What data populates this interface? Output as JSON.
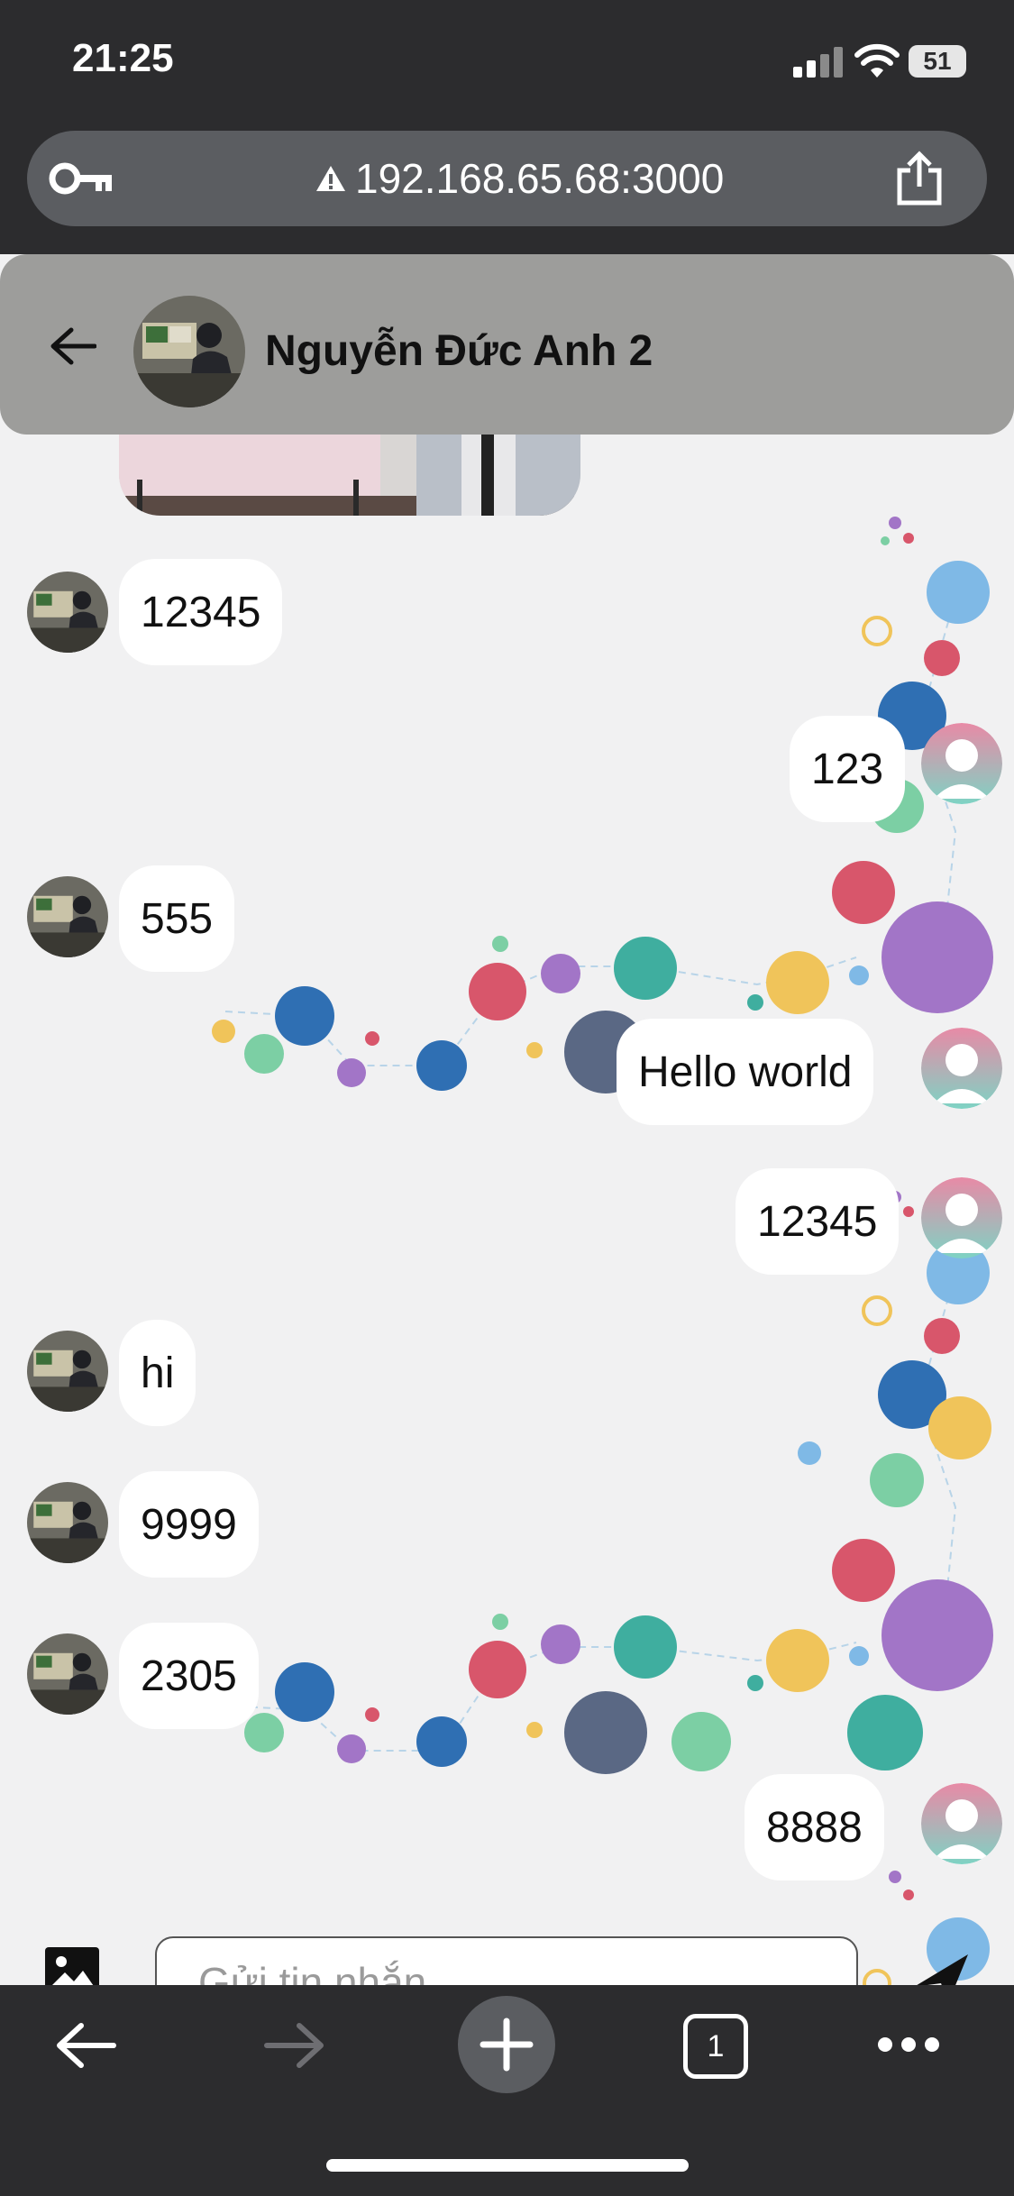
{
  "status_bar": {
    "time": "21:25",
    "battery": "51"
  },
  "browser": {
    "url": "192.168.65.68:3000"
  },
  "chat_header": {
    "contact_name": "Nguyễn Đức Anh 2"
  },
  "messages": [
    {
      "side": "received",
      "text": "12345"
    },
    {
      "side": "sent",
      "text": "123"
    },
    {
      "side": "received",
      "text": "555"
    },
    {
      "side": "sent",
      "text": "Hello world"
    },
    {
      "side": "sent",
      "text": "12345"
    },
    {
      "side": "received",
      "text": "hi"
    },
    {
      "side": "received",
      "text": "9999"
    },
    {
      "side": "received",
      "text": "2305"
    },
    {
      "side": "sent",
      "text": "8888"
    }
  ],
  "composer": {
    "placeholder": "Gửi tin nhắn"
  },
  "toolbar": {
    "tab_count": "1"
  },
  "colors": {
    "chrome": "#2c2c2e",
    "header": "#9d9d9b",
    "chat_bg": "#f1f1f2",
    "bubble": "#ffffff"
  }
}
